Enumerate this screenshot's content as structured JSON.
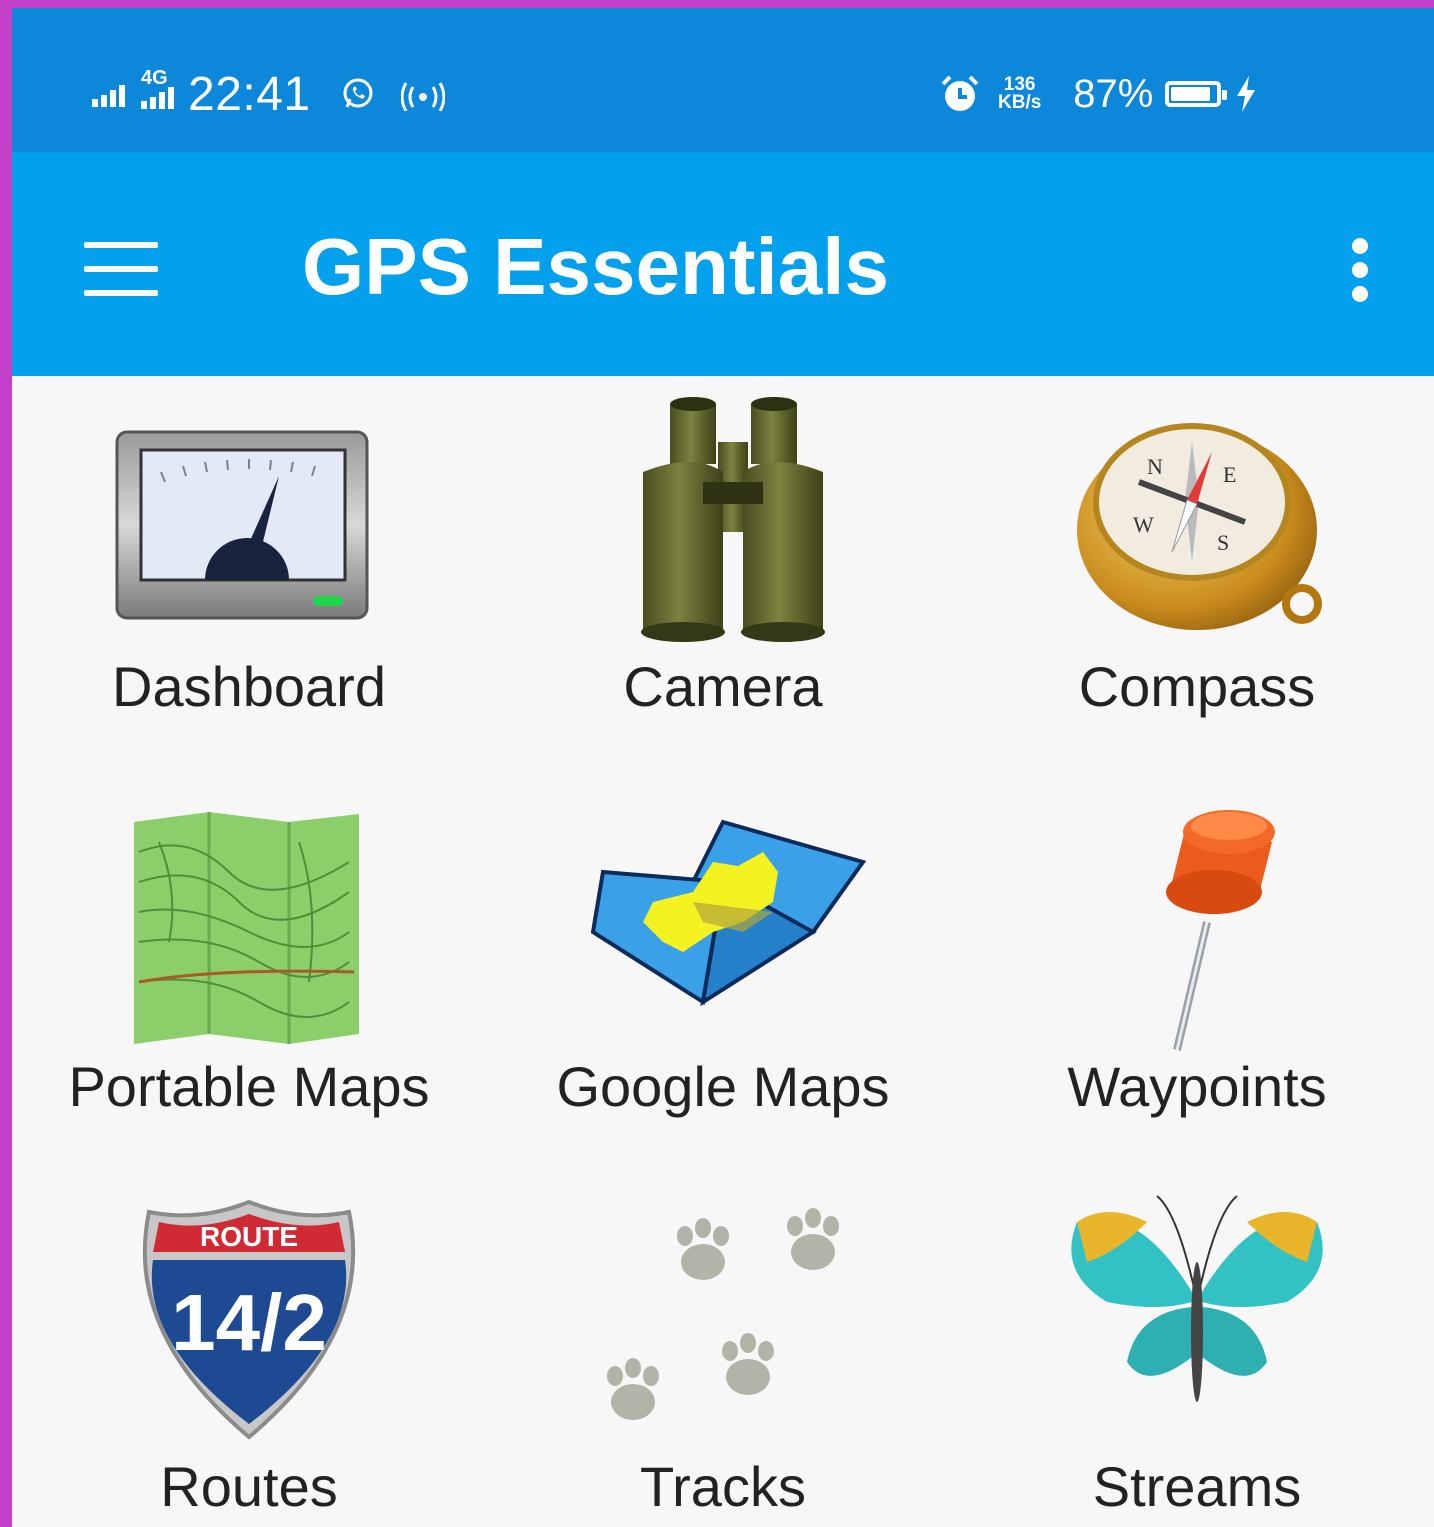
{
  "status_bar": {
    "network_type": "4G",
    "time": "22:41",
    "speed_value": "136",
    "speed_unit": "KB/s",
    "battery_percent": "87%",
    "battery_level": 0.87,
    "icons": [
      "signal-icon",
      "signal-4g-icon",
      "whatsapp-icon",
      "hotspot-icon",
      "alarm-icon",
      "battery-icon",
      "charging-icon"
    ]
  },
  "app_bar": {
    "title": "GPS Essentials",
    "menu_icon": "hamburger-menu-icon",
    "overflow_icon": "more-vertical-icon"
  },
  "tiles": [
    {
      "label": "Dashboard",
      "icon": "speedometer-gauge-icon"
    },
    {
      "label": "Camera",
      "icon": "binoculars-icon"
    },
    {
      "label": "Compass",
      "icon": "compass-icon"
    },
    {
      "label": "Portable Maps",
      "icon": "topographic-map-icon"
    },
    {
      "label": "Google Maps",
      "icon": "folded-map-icon"
    },
    {
      "label": "Waypoints",
      "icon": "pushpin-icon"
    },
    {
      "label": "Routes",
      "icon": "route-shield-icon",
      "shield_top": "ROUTE",
      "shield_number": "14/2"
    },
    {
      "label": "Tracks",
      "icon": "paw-tracks-icon"
    },
    {
      "label": "Streams",
      "icon": "butterfly-icon"
    }
  ],
  "colors": {
    "status_bar": "#0c87d9",
    "app_bar": "#03a0ee",
    "background": "#f7f7f7",
    "label_text": "#222222"
  }
}
